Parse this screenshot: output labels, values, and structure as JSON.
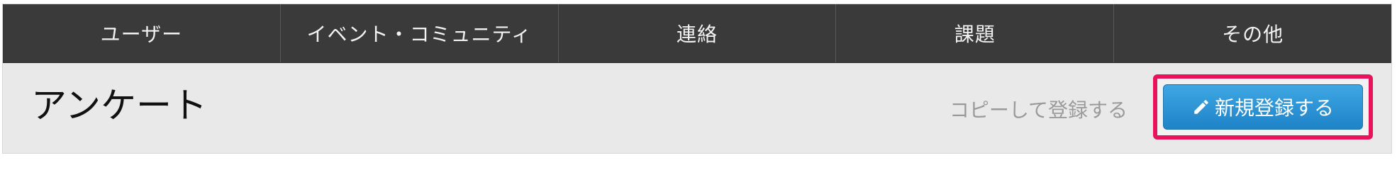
{
  "nav": {
    "items": [
      {
        "label": "ユーザー"
      },
      {
        "label": "イベント・コミュニティ"
      },
      {
        "label": "連絡"
      },
      {
        "label": "課題"
      },
      {
        "label": "その他"
      }
    ]
  },
  "page": {
    "title": "アンケート",
    "copy_link": "コピーして登録する",
    "new_button": "新規登録する",
    "new_button_icon": "pencil-icon"
  },
  "colors": {
    "nav_bg": "#3a3a3a",
    "content_bg": "#e9e9e9",
    "button_blue": "#2a95d6",
    "highlight": "#e8135a"
  }
}
